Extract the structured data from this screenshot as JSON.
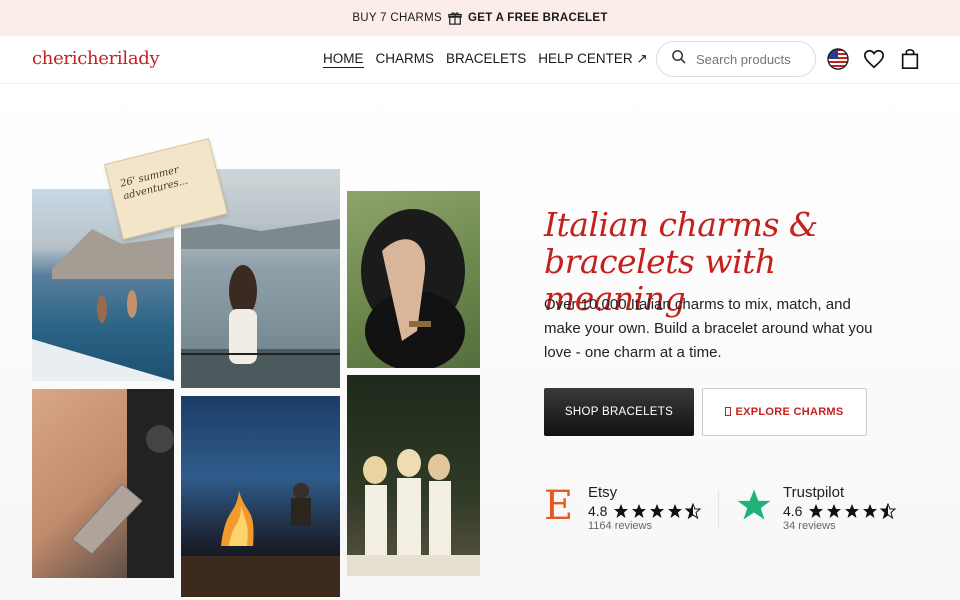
{
  "topbar": {
    "left_text": "BUY 7 CHARMS",
    "right_text": "GET A FREE BRACELET"
  },
  "brand": {
    "logo": "chericherilady",
    "color": "#c4211d"
  },
  "nav": {
    "items": [
      {
        "label": "HOME",
        "active": true
      },
      {
        "label": "CHARMS"
      },
      {
        "label": "BRACELETS"
      },
      {
        "label": "HELP CENTER ↗"
      }
    ]
  },
  "search": {
    "placeholder": "Search products"
  },
  "icons": {
    "search": "search-icon",
    "flag": "us-flag-icon",
    "wishlist": "heart-icon",
    "cart": "bag-icon",
    "gift": "gift-icon"
  },
  "hero": {
    "stamp_text": "26' summer adventures...",
    "headline_line1": "Italian charms &",
    "headline_line2": "bracelets with meaning",
    "subtext": "Over 10,000 Italian charms to mix, match, and make your own. Build a bracelet around what you love - one charm at a time.",
    "primary_button": "SHOP BRACELETS",
    "secondary_button": "EXPLORE CHARMS"
  },
  "reviews": [
    {
      "platform": "Etsy",
      "score": "4.8",
      "count": "1164 reviews",
      "stars": 4.5
    },
    {
      "platform": "Trustpilot",
      "score": "4.6",
      "count": "34 reviews",
      "stars": 4.5
    }
  ]
}
